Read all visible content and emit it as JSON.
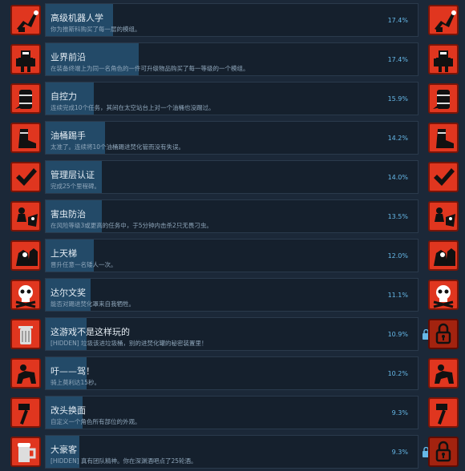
{
  "achievements": [
    {
      "title": "高级机器人学",
      "desc": "你为推斯科购买了每一层的模组。",
      "percent": "17.4%",
      "fill": 0.18,
      "icon": "robot-arm-icon",
      "locked": false
    },
    {
      "title": "业界前沿",
      "desc": "在装备终端上为同一名角色的一件可升级物品购买了每一等级的一个模组。",
      "percent": "17.4%",
      "fill": 0.25,
      "icon": "robot-icon",
      "locked": false
    },
    {
      "title": "自控力",
      "desc": "连续完成10个任务，其间在太空站台上对一个油桶也没踢过。",
      "percent": "15.9%",
      "fill": 0.13,
      "icon": "barrel-icon",
      "locked": false
    },
    {
      "title": "油桶踢手",
      "desc": "太准了。连续将10个油桶踢进焚化管而没有失误。",
      "percent": "14.2%",
      "fill": 0.16,
      "icon": "boot-icon",
      "locked": false
    },
    {
      "title": "管理层认证",
      "desc": "完成25个里程碑。",
      "percent": "14.0%",
      "fill": 0.15,
      "icon": "checkmark-icon",
      "locked": false
    },
    {
      "title": "害虫防治",
      "desc": "在风险等级3或更高的任务中，于5分钟内击杀2只无畏刁虫。",
      "percent": "13.5%",
      "fill": 0.15,
      "icon": "bug-fight-icon",
      "locked": false
    },
    {
      "title": "上天梯",
      "desc": "晋升任意一名矮人一次。",
      "percent": "12.0%",
      "fill": 0.13,
      "icon": "dwarf-promote-icon",
      "locked": false
    },
    {
      "title": "达尔文奖",
      "desc": "能否对踢进焚化罩来自我牺牲。",
      "percent": "11.1%",
      "fill": 0.12,
      "icon": "skull-icon",
      "locked": false
    },
    {
      "title": "这游戏不是这样玩的",
      "desc": "[HIDDEN] 垃圾该进垃圾桶，别的进焚化罐的秘密装置里！",
      "percent": "10.9%",
      "fill": 0.11,
      "icon": "trash-can-icon",
      "locked": true
    },
    {
      "title": "吁——驾！",
      "desc": "骑上莫利达15秒。",
      "percent": "10.2%",
      "fill": 0.11,
      "icon": "ride-icon",
      "locked": false
    },
    {
      "title": "改头换面",
      "desc": "自定义一个角色所有部位的外观。",
      "percent": "9.3%",
      "fill": 0.1,
      "icon": "hammer-icon",
      "locked": false
    },
    {
      "title": "大豪客",
      "desc": "[HIDDEN] 真有团队精神。你在深渊酒吧点了25轮酒。",
      "percent": "9.3%",
      "fill": 0.09,
      "icon": "beer-mug-icon",
      "locked": true
    }
  ],
  "colors": {
    "background": "#1b2838",
    "bar_fill": "#234a68",
    "icon_red": "#e0361f",
    "percent_blue": "#66b8e8"
  }
}
